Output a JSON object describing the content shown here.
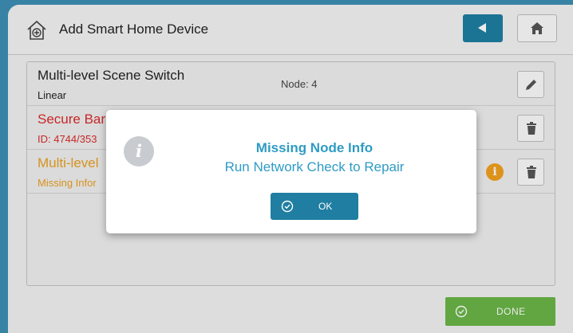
{
  "header": {
    "title": "Add Smart Home Device",
    "icons": {
      "device": "add-device-house-icon",
      "back": "back-arrow-icon",
      "home": "home-icon"
    }
  },
  "devices": [
    {
      "name": "Multi-level Scene Switch",
      "sub": "Linear",
      "node": "Node: 4",
      "color": "#222222",
      "actions": [
        "edit"
      ]
    },
    {
      "name": "Secure Bar",
      "sub": "ID: 4744/353",
      "node": "",
      "color": "#d92b2b",
      "actions": [
        "delete"
      ]
    },
    {
      "name": "Multi-level",
      "sub": "Missing Infor",
      "node": "",
      "color": "#e8a020",
      "actions": [
        "info",
        "delete"
      ]
    }
  ],
  "footer": {
    "done_label": "DONE"
  },
  "modal": {
    "title": "Missing Node Info",
    "message": "Run Network Check to Repair",
    "ok_label": "OK"
  },
  "colors": {
    "accent": "#1f7ea1",
    "done": "#6ab547",
    "error": "#d92b2b",
    "warning": "#e8a020",
    "modal_text": "#2f9bc4"
  }
}
